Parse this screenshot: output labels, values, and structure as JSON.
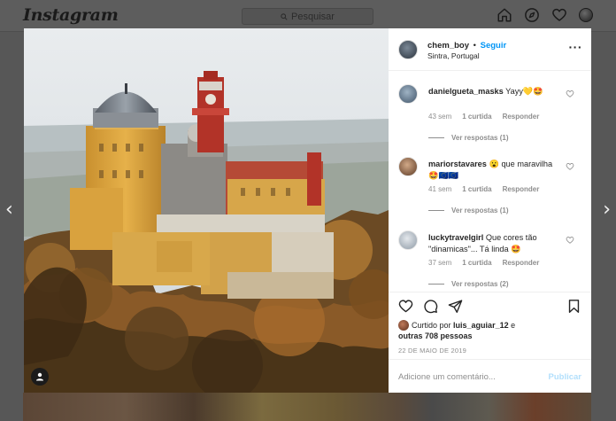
{
  "app": {
    "logo_text": "Instagram"
  },
  "topbar": {
    "search_placeholder": "Pesquisar",
    "icons": [
      "home-icon",
      "explore-compass-icon",
      "heart-icon",
      "profile-avatar"
    ]
  },
  "post": {
    "author": "chem_boy",
    "follow_label": "Seguir",
    "separator": "•",
    "location": "Sintra, Portugal",
    "more_label": "···",
    "image_description_icon": "user-tag-icon"
  },
  "comments": [
    {
      "username": "danielgueta_masks",
      "text": "Yayy💛🤩",
      "time": "43 sem",
      "likes": "1 curtida",
      "reply_label": "Responder",
      "view_replies": "Ver respostas (1)",
      "avatar_color": "#8aa1b4"
    },
    {
      "username": "mariorstavares",
      "text": "😮 que maravilha 🤩🇪🇺🇪🇺",
      "time": "41 sem",
      "likes": "1 curtida",
      "reply_label": "Responder",
      "view_replies": "Ver respostas (1)",
      "avatar_color": "#b68a6a"
    },
    {
      "username": "luckytravelgirl",
      "text": "Que cores tão \"dinamicas\"... Tá linda 🤩",
      "time": "37 sem",
      "likes": "1 curtida",
      "reply_label": "Responder",
      "view_replies": "Ver respostas (2)",
      "avatar_color": "#c8d0d8"
    }
  ],
  "actions": {
    "icons": [
      "like-heart-icon",
      "comment-bubble-icon",
      "share-paper-plane-icon",
      "save-bookmark-icon"
    ],
    "liked_by_prefix": "Curtido por",
    "liked_by_user": "luis_aguiar_12",
    "liked_by_conj": "e",
    "liked_by_others": "outras 708 pessoas",
    "date": "22 DE MAIO DE 2019"
  },
  "add_comment": {
    "placeholder": "Adicione um comentário...",
    "post_label": "Publicar"
  },
  "navigation": {
    "prev_label": "‹",
    "next_label": "›"
  },
  "colors": {
    "accent_blue": "#0095f6",
    "post_button_disabled": "#b2dffc",
    "overlay": "#575757",
    "muted_text": "#8e8e8e"
  }
}
